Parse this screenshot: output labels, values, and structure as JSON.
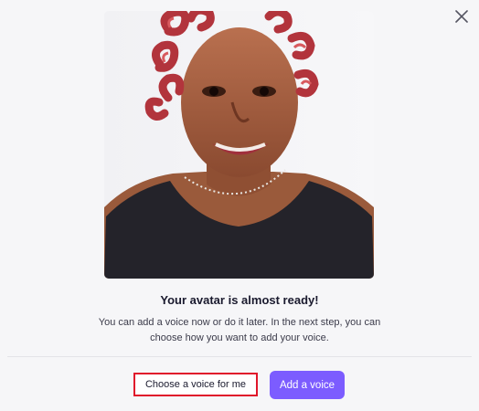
{
  "dialog": {
    "close_icon": "close-icon",
    "avatar_image": "avatar-preview-photo",
    "title": "Your avatar is almost ready!",
    "description": "You can add a voice now or do it later. In the next step, you can choose how you want to add your voice.",
    "secondary_button": "Choose a voice for me",
    "primary_button": "Add a voice"
  },
  "colors": {
    "accent": "#7c5cff",
    "highlight_border": "#e0162b",
    "background": "#f6f6f8"
  }
}
